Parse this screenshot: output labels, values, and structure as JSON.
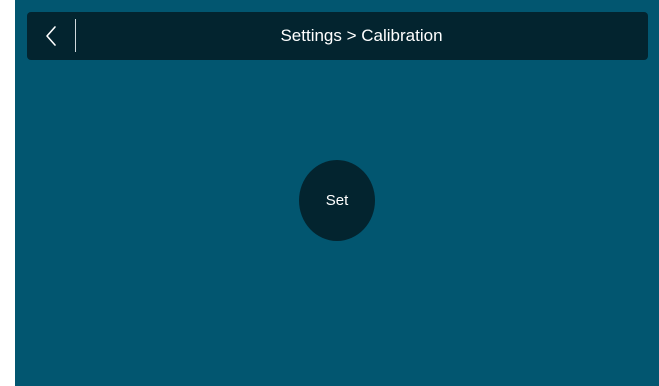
{
  "header": {
    "title": "Settings > Calibration",
    "back_icon": "chevron-left-icon"
  },
  "main": {
    "set_label": "Set"
  },
  "colors": {
    "background": "#025670",
    "bar": "#03242f",
    "text": "#ffffff"
  }
}
